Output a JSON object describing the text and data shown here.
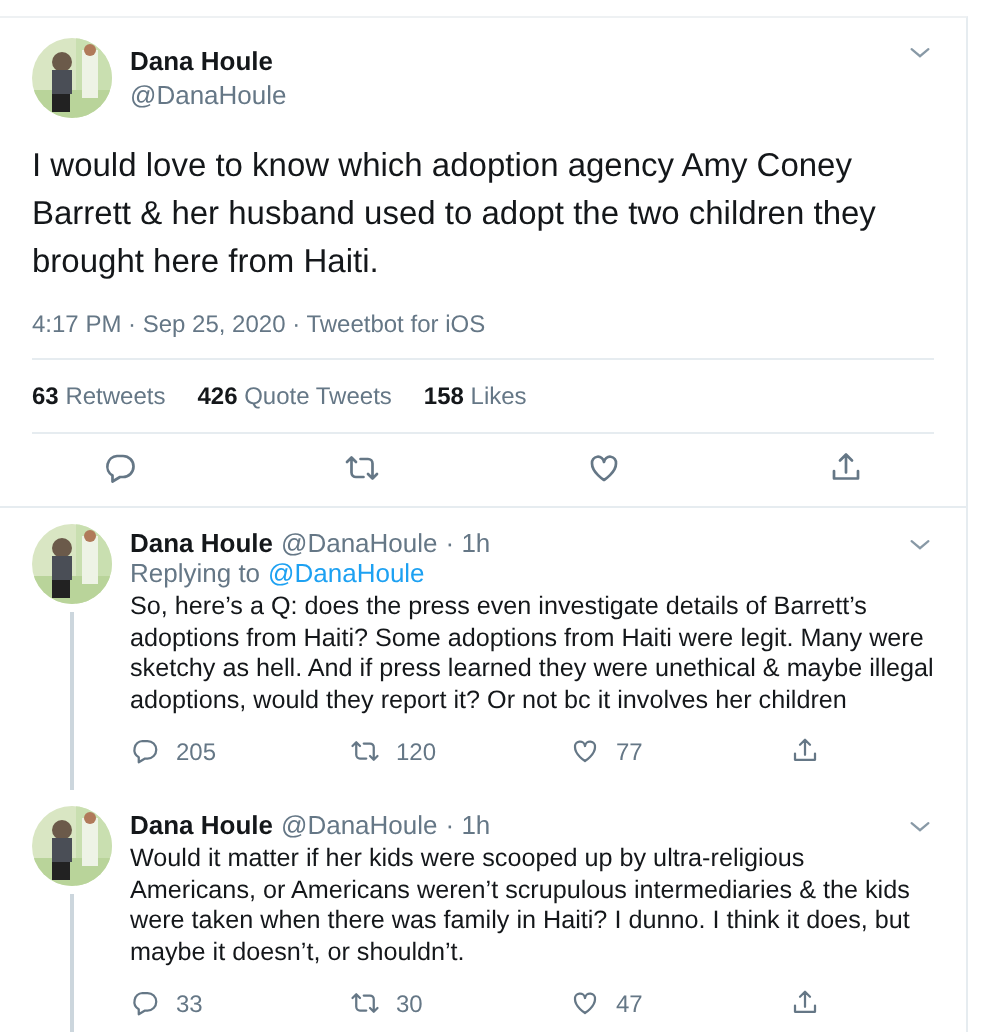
{
  "main_tweet": {
    "name": "Dana Houle",
    "handle": "@DanaHoule",
    "text": "I would love to know which adoption agency Amy Coney Barrett & her husband used to adopt the two children they brought here from Haiti.",
    "meta": "4:17 PM · Sep 25, 2020 · Tweetbot for iOS",
    "stats": [
      {
        "count": "63",
        "label": "Retweets"
      },
      {
        "count": "426",
        "label": "Quote Tweets"
      },
      {
        "count": "158",
        "label": "Likes"
      }
    ]
  },
  "replies": [
    {
      "name": "Dana Houle",
      "handle": "@DanaHoule",
      "time": "· 1h",
      "replying_label": "Replying to",
      "replying_to": "@DanaHoule",
      "text": "So, here’s a Q: does the press even investigate details of Barrett’s adoptions from Haiti? Some adoptions from Haiti were legit. Many were sketchy as hell. And if press learned they were unethical & maybe illegal adoptions, would they report it? Or not bc it involves her children",
      "replies": "205",
      "retweets": "120",
      "likes": "77"
    },
    {
      "name": "Dana Houle",
      "handle": "@DanaHoule",
      "time": "· 1h",
      "text": "Would it matter if her kids were scooped up by ultra-religious Americans, or Americans weren’t scrupulous intermediaries & the kids were taken when there was family in Haiti? I dunno. I think it does, but maybe it doesn’t, or shouldn’t.",
      "replies": "33",
      "retweets": "30",
      "likes": "47"
    }
  ]
}
